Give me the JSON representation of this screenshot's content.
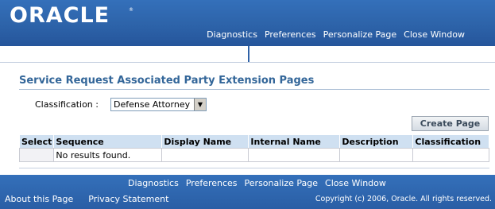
{
  "header": {
    "logo_text": "ORACLE",
    "logo_mark": "®",
    "links": [
      "Diagnostics",
      "Preferences",
      "Personalize Page",
      "Close Window"
    ]
  },
  "page": {
    "title": "Service Request Associated Party Extension Pages",
    "classification_label": "Classification :",
    "classification_value": "Defense Attorney",
    "create_button": "Create Page"
  },
  "table": {
    "columns": [
      "Select",
      "Sequence",
      "Display Name",
      "Internal Name",
      "Description",
      "Classification"
    ],
    "empty_message": "No results found."
  },
  "footer": {
    "links": [
      "Diagnostics",
      "Preferences",
      "Personalize Page",
      "Close Window"
    ],
    "about": "About this Page",
    "privacy": "Privacy Statement",
    "copyright": "Copyright (c) 2006, Oracle. All rights reserved."
  },
  "colors": {
    "brand_blue": "#2f62a7",
    "title_blue": "#336699",
    "table_header": "#cfe0f1"
  },
  "icons": {
    "select_arrow": "chevron-down-icon"
  }
}
